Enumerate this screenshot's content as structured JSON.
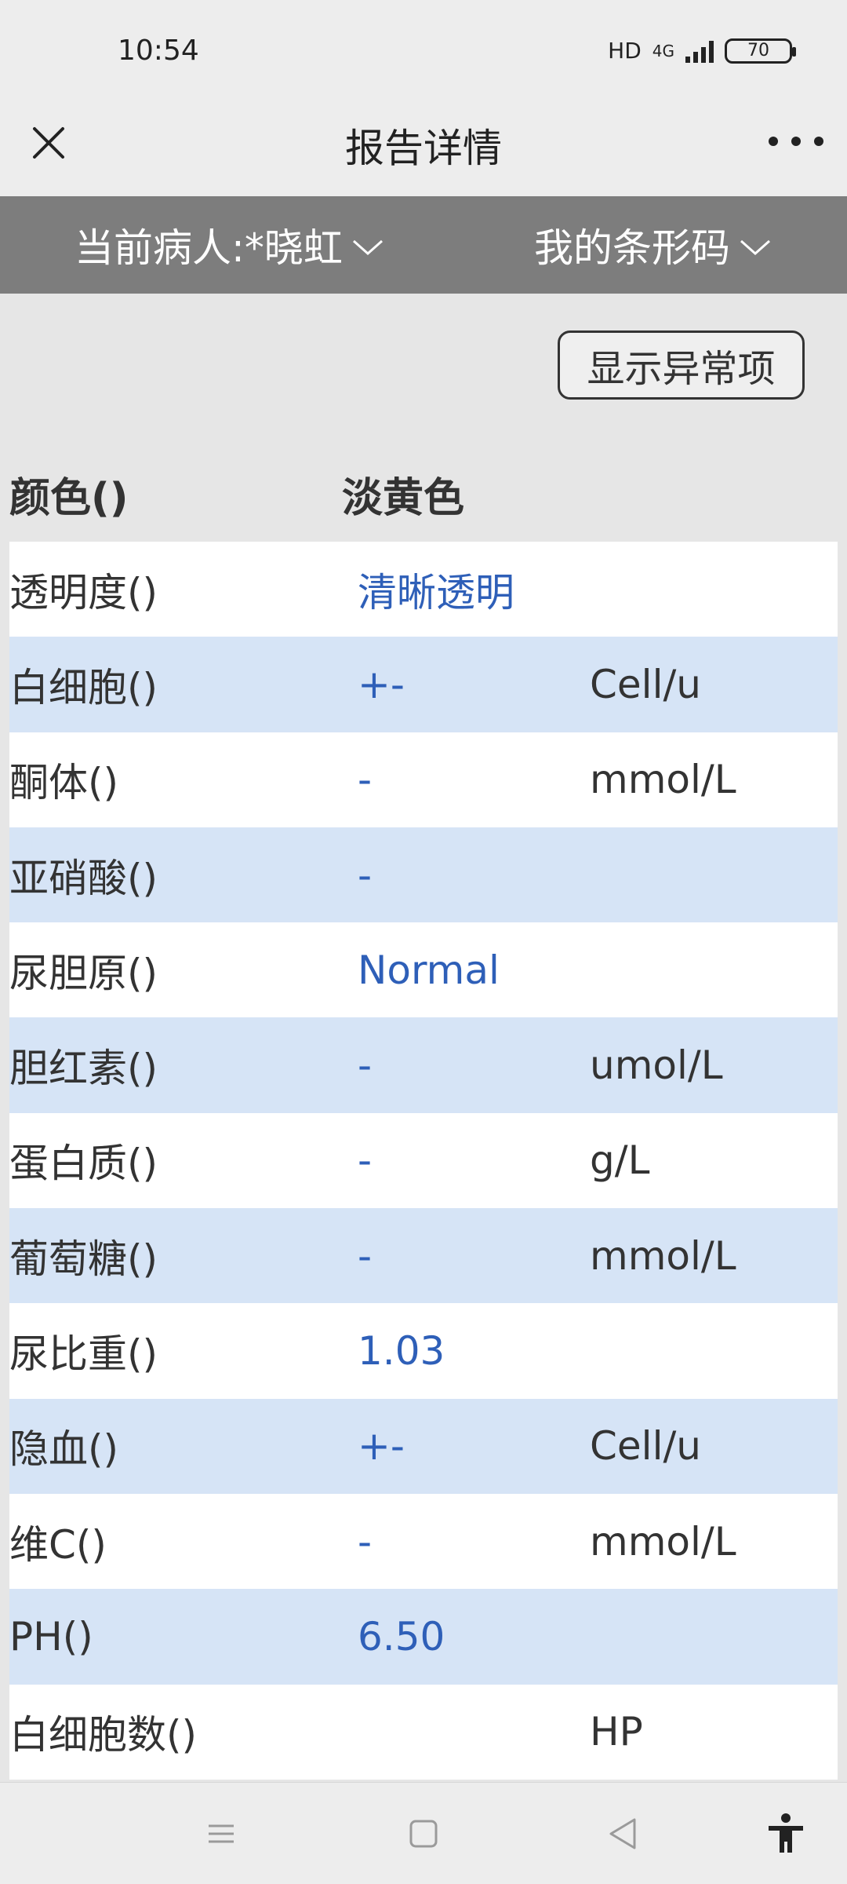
{
  "status_bar": {
    "time": "10:54",
    "hd_label": "HD",
    "network_label": "4G",
    "battery": "70"
  },
  "title_bar": {
    "title": "报告详情"
  },
  "filter_bar": {
    "patient_label": "当前病人:*晓虹",
    "barcode_label": "我的条形码"
  },
  "content": {
    "abnormal_button_label": "显示异常项",
    "first_row": {
      "name": "颜色()",
      "value": "淡黄色"
    },
    "rows": [
      {
        "name": "透明度()",
        "value": "清晰透明",
        "unit": ""
      },
      {
        "name": "白细胞()",
        "value": "+-",
        "unit": "Cell/u"
      },
      {
        "name": "酮体()",
        "value": "-",
        "unit": "mmol/L"
      },
      {
        "name": "亚硝酸()",
        "value": "-",
        "unit": ""
      },
      {
        "name": "尿胆原()",
        "value": "Normal",
        "unit": ""
      },
      {
        "name": "胆红素()",
        "value": "-",
        "unit": "umol/L"
      },
      {
        "name": "蛋白质()",
        "value": "-",
        "unit": "g/L"
      },
      {
        "name": "葡萄糖()",
        "value": "-",
        "unit": "mmol/L"
      },
      {
        "name": "尿比重()",
        "value": "1.03",
        "unit": ""
      },
      {
        "name": "隐血()",
        "value": "+-",
        "unit": "Cell/u"
      },
      {
        "name": "维C()",
        "value": "-",
        "unit": "mmol/L"
      },
      {
        "name": "PH()",
        "value": "6.50",
        "unit": ""
      },
      {
        "name": "白细胞数()",
        "value": "",
        "unit": "HP"
      }
    ]
  },
  "colors": {
    "filter_bar_bg": "#7d7d7d",
    "row_blue": "#d6e4f6",
    "value_blue": "#2e5fb8"
  }
}
